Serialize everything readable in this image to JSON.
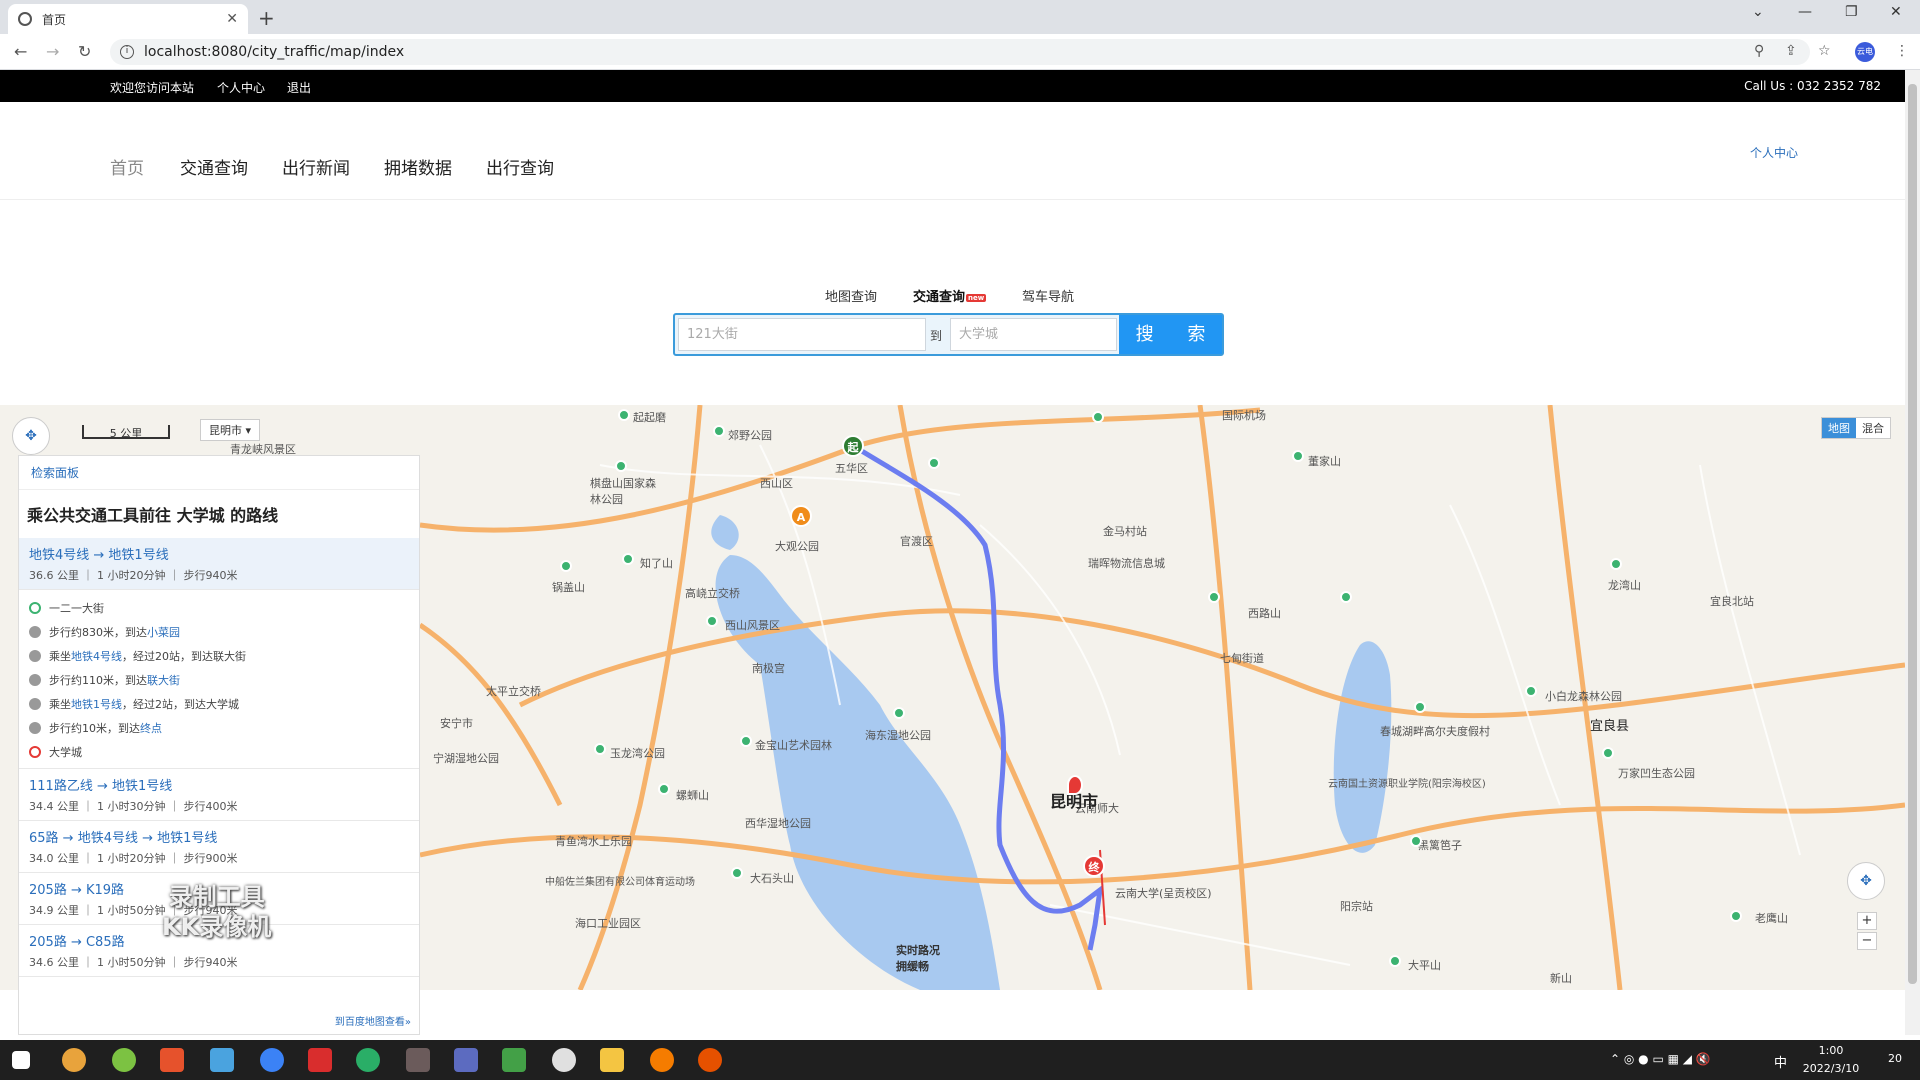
{
  "browser": {
    "tab_title": "首页",
    "url": "localhost:8080/city_traffic/map/index",
    "avatar_label": "云电"
  },
  "topbar": {
    "welcome": "欢迎您访问本站",
    "personal": "个人中心",
    "logout": "退出",
    "call": "Call Us : 032 2352 782"
  },
  "nav": {
    "items": [
      "首页",
      "交通查询",
      "出行新闻",
      "拥堵数据",
      "出行查询"
    ],
    "user_center": "个人中心"
  },
  "search": {
    "tabs": [
      "地图查询",
      "交通查询",
      "驾车导航"
    ],
    "new_badge": "new",
    "from_placeholder": "121大街",
    "to_label": "到",
    "to_placeholder": "大学城",
    "button": "搜 索"
  },
  "map": {
    "scale": "5 公里",
    "city": "昆明市",
    "type_map": "地图",
    "type_hybrid": "混合",
    "city_label": "昆明市",
    "traffic_note": "实时路况\n拥缓畅",
    "labels": [
      "西山区",
      "五华区",
      "官渡区",
      "大观公园",
      "高峣立交桥",
      "西山风景区",
      "南极宫",
      "知了山",
      "锅盖山",
      "太平立交桥",
      "安宁市",
      "宁湖湿地公园",
      "玉龙湾公园",
      "金宝山艺术园林",
      "海东湿地公园",
      "西华湿地公园",
      "螺蛳山",
      "青鱼湾水上乐园",
      "大石头山",
      "中船佐兰集团有限公司体育运动场",
      "海口工业园区",
      "云南师大",
      "云南大学(呈贡校区)",
      "金马村站",
      "瑞晖物流信息城",
      "西路山",
      "七甸街道",
      "春城湖畔高尔夫度假村",
      "云南国土资源职业学院(阳宗海校区)",
      "黑篱笆子",
      "阳宗站",
      "宜良北站",
      "小白龙森林公园",
      "万家凹生态公园",
      "董家山",
      "国际机场",
      "郊野公园",
      "起起磨",
      "棋盘山国家森林公园",
      "青龙峡风景区",
      "龙湾山",
      "宜良县",
      "老鹰山",
      "大平山",
      "新山"
    ]
  },
  "panel": {
    "head": "检索面板",
    "title": "乘公共交通工具前往 大学城 的路线",
    "routes": [
      {
        "name": "地铁4号线 → 地铁1号线",
        "meta": "36.6 公里 ｜ 1 小时20分钟 ｜ 步行940米"
      },
      {
        "name": "111路乙线 → 地铁1号线",
        "meta": "34.4 公里 ｜ 1 小时30分钟 ｜ 步行400米"
      },
      {
        "name": "65路 → 地铁4号线 → 地铁1号线",
        "meta": "34.0 公里 ｜ 1 小时20分钟 ｜ 步行900米"
      },
      {
        "name": "205路 → K19路",
        "meta": "34.9 公里 ｜ 1 小时50分钟 ｜ 步行940米"
      },
      {
        "name": "205路 → C85路",
        "meta": "34.6 公里 ｜ 1 小时50分钟 ｜ 步行940米"
      }
    ],
    "steps": [
      {
        "kind": "start",
        "pre": "一二一大街",
        "hl": "",
        "post": ""
      },
      {
        "kind": "walk",
        "pre": "步行约830米，到达",
        "hl": "小菜园",
        "post": ""
      },
      {
        "kind": "bus",
        "pre": "乘坐",
        "hl": "地铁4号线",
        "post": "，经过20站，到达联大街"
      },
      {
        "kind": "walk",
        "pre": "步行约110米，到达",
        "hl": "联大街",
        "post": ""
      },
      {
        "kind": "bus",
        "pre": "乘坐",
        "hl": "地铁1号线",
        "post": "，经过2站，到达大学城"
      },
      {
        "kind": "walk",
        "pre": "步行约10米，到达",
        "hl": "终点",
        "post": ""
      },
      {
        "kind": "end",
        "pre": "大学城",
        "hl": "",
        "post": ""
      }
    ],
    "footer": "到百度地图查看»"
  },
  "watermark": {
    "line1": "录制工具",
    "line2": "KK录像机"
  },
  "taskbar": {
    "time": "1:00",
    "date": "2022/3/10",
    "ime": "中",
    "notif": "20"
  }
}
